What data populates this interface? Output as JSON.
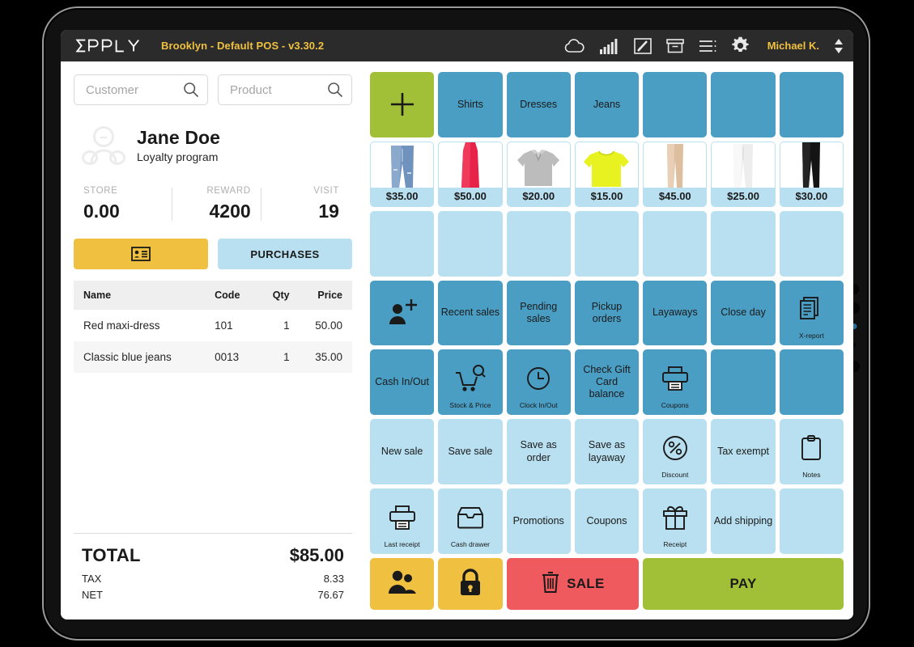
{
  "header": {
    "logo": "ERPLY",
    "title": "Brooklyn - Default POS - v3.30.2",
    "icons": [
      "cloud-icon",
      "signal-icon",
      "pen-box-icon",
      "archive-icon",
      "list-icon",
      "gear-icon"
    ],
    "username": "Michael K."
  },
  "search": {
    "customer_placeholder": "Customer",
    "product_placeholder": "Product"
  },
  "customer": {
    "name": "Jane Doe",
    "subtitle": "Loyalty program",
    "stats": [
      {
        "label": "STORE",
        "value": "0.00"
      },
      {
        "label": "REWARD",
        "value": "4200"
      },
      {
        "label": "VISIT",
        "value": "19"
      }
    ]
  },
  "tabs": {
    "card_label": "",
    "purchases_label": "PURCHASES"
  },
  "cart": {
    "columns": [
      "Name",
      "Code",
      "Qty",
      "Price"
    ],
    "rows": [
      {
        "name": "Red maxi-dress",
        "code": "101",
        "qty": "1",
        "price": "50.00"
      },
      {
        "name": "Classic blue jeans",
        "code": "0013",
        "qty": "1",
        "price": "35.00"
      }
    ]
  },
  "totals": {
    "total_label": "TOTAL",
    "total_value": "$85.00",
    "tax_label": "TAX",
    "tax_value": "8.33",
    "net_label": "NET",
    "net_value": "76.67"
  },
  "colors": {
    "blue": "#4a9ec4",
    "light_blue": "#b8e0f0",
    "green": "#a2c037",
    "yellow": "#f0c040",
    "red": "#ef5a5f",
    "dark": "#2b2b2b",
    "accent_text": "#f0c040"
  },
  "grid": {
    "rows": [
      [
        {
          "kind": "green",
          "icon": "plus-icon",
          "label": ""
        },
        {
          "kind": "blue",
          "label": "Shirts"
        },
        {
          "kind": "blue",
          "label": "Dresses"
        },
        {
          "kind": "blue",
          "label": "Jeans"
        },
        {
          "kind": "blue",
          "label": ""
        },
        {
          "kind": "blue",
          "label": ""
        },
        {
          "kind": "blue",
          "label": ""
        }
      ],
      [
        {
          "kind": "product",
          "image": "blue-jeans",
          "price": "$35.00"
        },
        {
          "kind": "product",
          "image": "red-dress",
          "price": "$50.00"
        },
        {
          "kind": "product",
          "image": "grey-polo",
          "price": "$20.00"
        },
        {
          "kind": "product",
          "image": "yellow-tshirt",
          "price": "$15.00"
        },
        {
          "kind": "product",
          "image": "beige-trousers",
          "price": "$45.00"
        },
        {
          "kind": "product",
          "image": "white-jeans",
          "price": "$25.00"
        },
        {
          "kind": "product",
          "image": "black-jeans",
          "price": "$30.00"
        }
      ],
      [
        {
          "kind": "lblue",
          "label": ""
        },
        {
          "kind": "lblue",
          "label": ""
        },
        {
          "kind": "lblue",
          "label": ""
        },
        {
          "kind": "lblue",
          "label": ""
        },
        {
          "kind": "lblue",
          "label": ""
        },
        {
          "kind": "lblue",
          "label": ""
        },
        {
          "kind": "lblue",
          "label": ""
        }
      ],
      [
        {
          "kind": "blue",
          "icon": "add-customer-icon",
          "label": ""
        },
        {
          "kind": "blue",
          "label": "Recent sales"
        },
        {
          "kind": "blue",
          "label": "Pending sales"
        },
        {
          "kind": "blue",
          "label": "Pickup orders"
        },
        {
          "kind": "blue",
          "label": "Layaways"
        },
        {
          "kind": "blue",
          "label": "Close day"
        },
        {
          "kind": "blue",
          "icon": "report-icon",
          "sublabel": "X-report"
        }
      ],
      [
        {
          "kind": "blue",
          "label": "Cash In/Out"
        },
        {
          "kind": "blue",
          "icon": "cart-search-icon",
          "sublabel": "Stock & Price"
        },
        {
          "kind": "blue",
          "icon": "clock-icon",
          "sublabel": "Clock In/Out"
        },
        {
          "kind": "blue",
          "label": "Check Gift Card balance"
        },
        {
          "kind": "blue",
          "icon": "printer-icon",
          "sublabel": "Coupons"
        },
        {
          "kind": "blue",
          "label": ""
        },
        {
          "kind": "blue",
          "label": ""
        }
      ],
      [
        {
          "kind": "lblue",
          "label": "New sale"
        },
        {
          "kind": "lblue",
          "label": "Save sale"
        },
        {
          "kind": "lblue",
          "label": "Save as order"
        },
        {
          "kind": "lblue",
          "label": "Save as layaway"
        },
        {
          "kind": "lblue",
          "icon": "percent-icon",
          "sublabel": "Discount"
        },
        {
          "kind": "lblue",
          "label": "Tax exempt"
        },
        {
          "kind": "lblue",
          "icon": "clipboard-icon",
          "sublabel": "Notes"
        }
      ],
      [
        {
          "kind": "lblue",
          "icon": "printer-icon",
          "sublabel": "Last receipt"
        },
        {
          "kind": "lblue",
          "icon": "drawer-icon",
          "sublabel": "Cash drawer"
        },
        {
          "kind": "lblue",
          "label": "Promotions"
        },
        {
          "kind": "lblue",
          "label": "Coupons"
        },
        {
          "kind": "lblue",
          "icon": "gift-icon",
          "sublabel": "Receipt"
        },
        {
          "kind": "lblue",
          "label": "Add shipping"
        },
        {
          "kind": "lblue",
          "label": ""
        }
      ]
    ],
    "actions": [
      {
        "kind": "yellow",
        "icon": "users-icon",
        "label": "",
        "span": 1
      },
      {
        "kind": "yellow",
        "icon": "lock-icon",
        "label": "",
        "span": 1
      },
      {
        "kind": "red",
        "icon": "trash-icon",
        "label": "SALE",
        "span": 2
      },
      {
        "kind": "green",
        "icon": "",
        "label": "PAY",
        "span": 3
      }
    ]
  }
}
